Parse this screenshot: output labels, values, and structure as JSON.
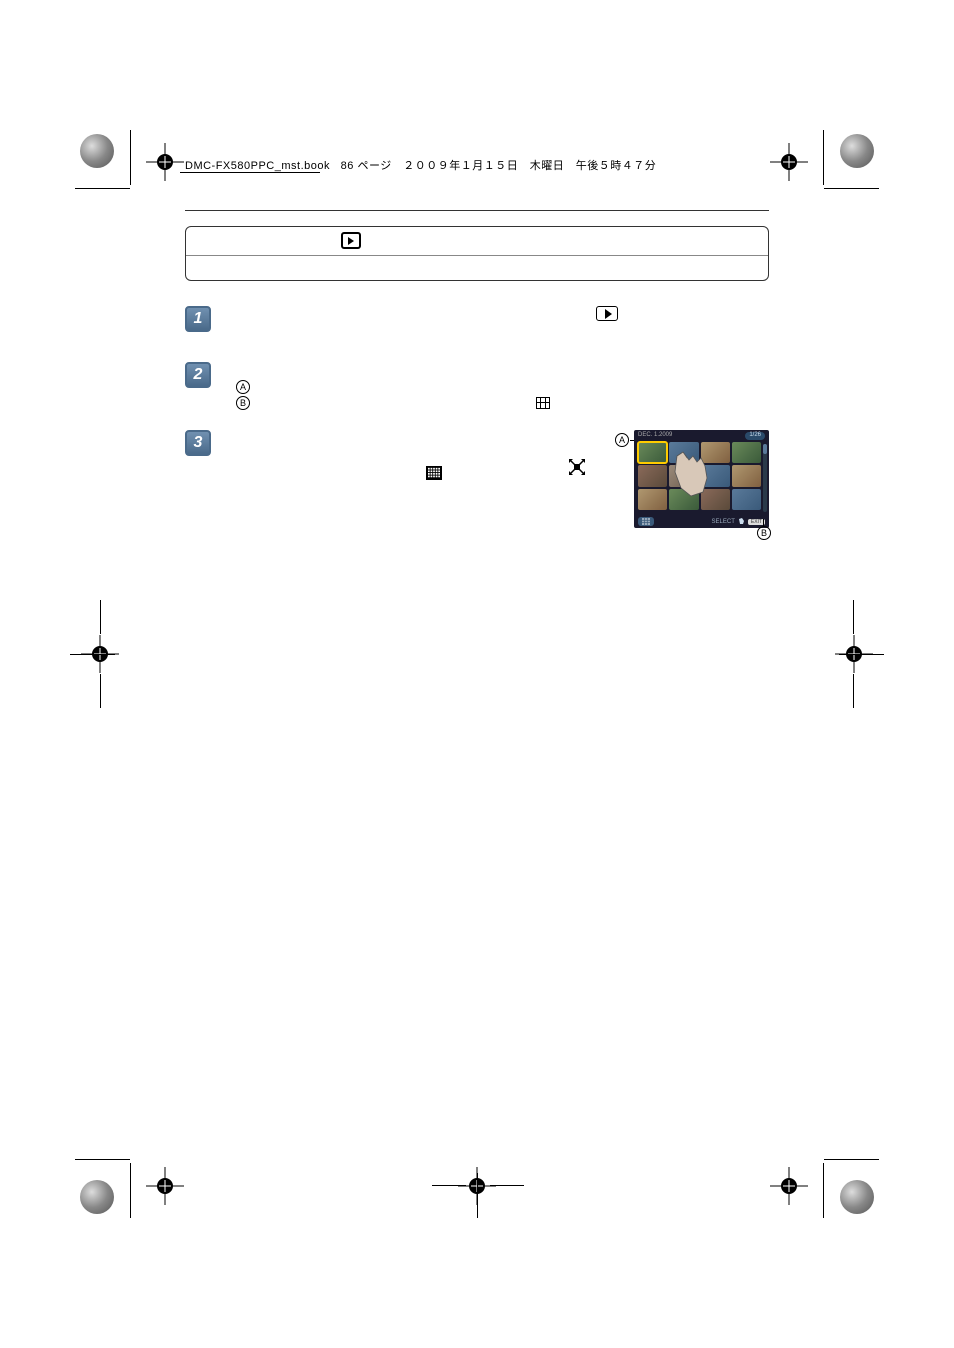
{
  "header": {
    "filename": "DMC-FX580PPC_mst.book",
    "page_text": "86 ページ　２００９年１月１５日　木曜日　午後５時４７分"
  },
  "title_box": {
    "icon_glyph": "▸"
  },
  "steps": {
    "step1": "1",
    "step2": "2",
    "step3": "3",
    "label_a": "A",
    "label_b": "B"
  },
  "thumbnail": {
    "date": "DEC. 1.2009",
    "counter": "1/26",
    "select_label": "SELECT",
    "exit_label": "EXIT"
  },
  "callouts": {
    "a": "A",
    "b": "B"
  }
}
